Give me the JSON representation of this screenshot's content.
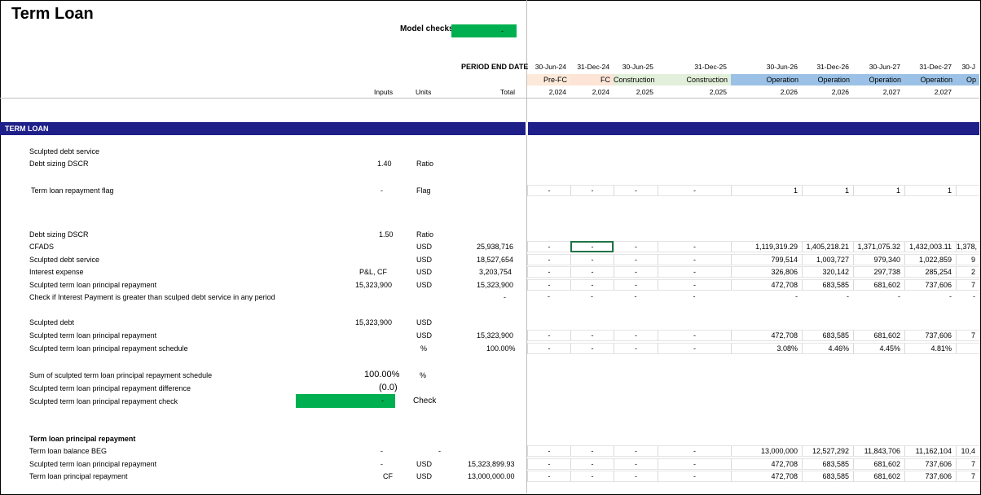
{
  "title": "Term Loan",
  "model_checks": {
    "label": "Model checks",
    "value": "-"
  },
  "header": {
    "period_end_label": "PERIOD END DATE",
    "inputs_label": "Inputs",
    "units_label": "Units",
    "total_label": "Total",
    "dates": [
      "30-Jun-24",
      "31-Dec-24",
      "30-Jun-25",
      "31-Dec-25",
      "30-Jun-26",
      "31-Dec-26",
      "30-Jun-27",
      "31-Dec-27",
      "30-J"
    ],
    "phases": [
      "Pre-FC",
      "FC",
      "Construction",
      "Construction",
      "Operation",
      "Operation",
      "Operation",
      "Operation",
      "Op"
    ],
    "years": [
      "2,024",
      "2,024",
      "2,025",
      "2,025",
      "2,026",
      "2,026",
      "2,027",
      "2,027",
      ""
    ]
  },
  "section_title": "TERM LOAN",
  "rows": {
    "sculpted_debt_service_heading": "Sculpted debt service",
    "dscr1": {
      "label": "Debt sizing DSCR",
      "input": "1.40",
      "unit": "Ratio"
    },
    "repay_flag": {
      "label": "Term loan repayment flag",
      "input": "-",
      "unit": "Flag",
      "values": [
        "-",
        "-",
        "-",
        "-",
        "1",
        "1",
        "1",
        "1",
        ""
      ]
    },
    "dscr2": {
      "label": "Debt sizing DSCR",
      "input": "1.50",
      "unit": "Ratio"
    },
    "cfads": {
      "label": "CFADS",
      "unit": "USD",
      "total": "25,938,716",
      "values": [
        "-",
        "-",
        "-",
        "-",
        "1,119,319.29",
        "1,405,218.21",
        "1,371,075.32",
        "1,432,003.11",
        "1,378,"
      ]
    },
    "sculpted_ds": {
      "label": "Sculpted debt service",
      "unit": "USD",
      "total": "18,527,654",
      "values": [
        "-",
        "-",
        "-",
        "-",
        "799,514",
        "1,003,727",
        "979,340",
        "1,022,859",
        "9"
      ]
    },
    "interest": {
      "label": "Interest expense",
      "input": "P&L, CF",
      "unit": "USD",
      "total": "3,203,754",
      "values": [
        "-",
        "-",
        "-",
        "-",
        "326,806",
        "320,142",
        "297,738",
        "285,254",
        "2"
      ]
    },
    "principal1": {
      "label": "Sculpted term loan principal repayment",
      "input": "15,323,900",
      "unit": "USD",
      "total": "15,323,900",
      "values": [
        "-",
        "-",
        "-",
        "-",
        "472,708",
        "683,585",
        "681,602",
        "737,606",
        "7"
      ]
    },
    "check_interest": {
      "label": "Check if Interest Payment is greater than sculped debt service in any period",
      "total": "-",
      "values": [
        "-",
        "-",
        "-",
        "-",
        "-",
        "-",
        "-",
        "-",
        "-"
      ]
    },
    "sculpted_debt": {
      "label": "Sculpted debt",
      "input": "15,323,900",
      "unit": "USD"
    },
    "principal2": {
      "label": "Sculpted term loan principal repayment",
      "unit": "USD",
      "total": "15,323,900",
      "values": [
        "-",
        "-",
        "-",
        "-",
        "472,708",
        "683,585",
        "681,602",
        "737,606",
        "7"
      ]
    },
    "schedule": {
      "label": "Sculpted term loan principal repayment schedule",
      "unit": "%",
      "total": "100.00%",
      "values": [
        "-",
        "-",
        "-",
        "-",
        "3.08%",
        "4.46%",
        "4.45%",
        "4.81%",
        ""
      ]
    },
    "sum_schedule": {
      "label": "Sum of sculpted term loan principal repayment schedule",
      "input": "100.00%",
      "unit": "%"
    },
    "difference": {
      "label": "Sculpted term loan principal repayment difference",
      "input": "(0.0)"
    },
    "check": {
      "label": "Sculpted term loan principal repayment check",
      "input": "-",
      "unit": "Check"
    },
    "principal_heading": "Term loan principal repayment",
    "balance_beg": {
      "label": "Term loan balance BEG",
      "input": "-",
      "unit": "-",
      "values": [
        "-",
        "-",
        "-",
        "-",
        "13,000,000",
        "12,527,292",
        "11,843,706",
        "11,162,104",
        "10,4"
      ]
    },
    "principal3": {
      "label": "Sculpted term loan principal repayment",
      "input": "-",
      "unit": "USD",
      "total": "15,323,899.93",
      "values": [
        "-",
        "-",
        "-",
        "-",
        "472,708",
        "683,585",
        "681,602",
        "737,606",
        "7"
      ]
    },
    "principal4": {
      "label": "Term loan principal repayment",
      "input": "CF",
      "unit": "USD",
      "total": "13,000,000.00",
      "values": [
        "-",
        "-",
        "-",
        "-",
        "472,708",
        "683,585",
        "681,602",
        "737,606",
        "7"
      ]
    }
  }
}
